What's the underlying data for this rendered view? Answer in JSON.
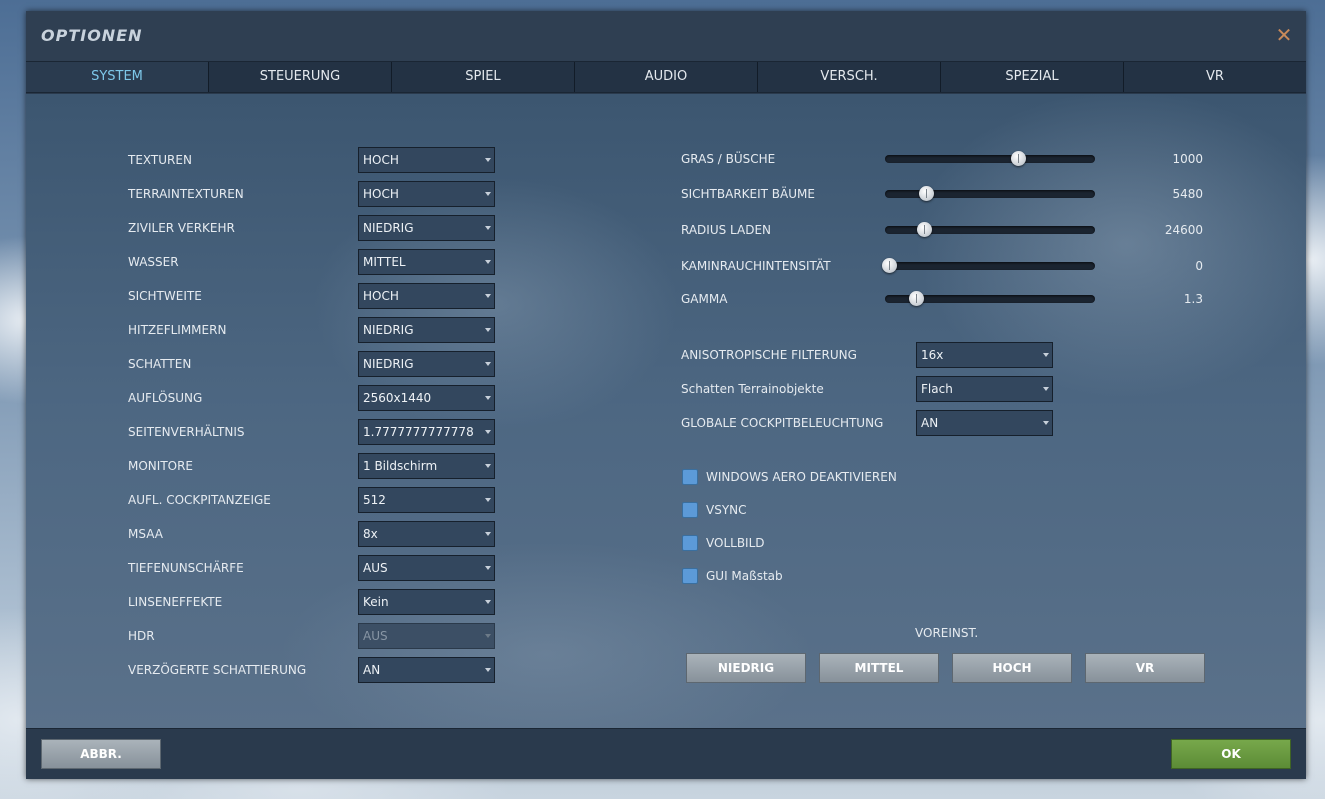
{
  "window": {
    "title": "OPTIONEN"
  },
  "tabs": [
    "SYSTEM",
    "STEUERUNG",
    "SPIEL",
    "AUDIO",
    "VERSCH.",
    "SPEZIAL",
    "VR"
  ],
  "left_settings": [
    {
      "label": "TEXTUREN",
      "value": "HOCH"
    },
    {
      "label": "TERRAINTEXTUREN",
      "value": "HOCH"
    },
    {
      "label": "ZIVILER VERKEHR",
      "value": "NIEDRIG"
    },
    {
      "label": "WASSER",
      "value": "MITTEL"
    },
    {
      "label": "SICHTWEITE",
      "value": "HOCH"
    },
    {
      "label": "HITZEFLIMMERN",
      "value": "NIEDRIG"
    },
    {
      "label": "SCHATTEN",
      "value": "NIEDRIG"
    },
    {
      "label": "AUFLÖSUNG",
      "value": "2560x1440"
    },
    {
      "label": "SEITENVERHÄLTNIS",
      "value": "1.7777777777778"
    },
    {
      "label": "MONITORE",
      "value": "1 Bildschirm"
    },
    {
      "label": "AUFL. COCKPITANZEIGE",
      "value": "512"
    },
    {
      "label": "MSAA",
      "value": "8x"
    },
    {
      "label": "TIEFENUNSCHÄRFE",
      "value": "AUS"
    },
    {
      "label": "LINSENEFFEKTE",
      "value": "Kein"
    },
    {
      "label": "HDR",
      "value": "AUS"
    },
    {
      "label": "VERZÖGERTE SCHATTIERUNG",
      "value": "AN"
    }
  ],
  "sliders": [
    {
      "label": "GRAS / BÜSCHE",
      "value": "1000",
      "fraction": 0.66
    },
    {
      "label": "SICHTBARKEIT BÄUME",
      "value": "5480",
      "fraction": 0.19
    },
    {
      "label": "RADIUS LADEN",
      "value": "24600",
      "fraction": 0.18
    },
    {
      "label": "KAMINRAUCHINTENSITÄT",
      "value": "0",
      "fraction": 0.0
    },
    {
      "label": "GAMMA",
      "value": "1.3",
      "fraction": 0.14
    }
  ],
  "right_settings": [
    {
      "label": "ANISOTROPISCHE FILTERUNG",
      "value": "16x"
    },
    {
      "label": "Schatten Terrainobjekte",
      "value": "Flach"
    },
    {
      "label": "GLOBALE COCKPITBELEUCHTUNG",
      "value": "AN"
    }
  ],
  "checkboxes": [
    {
      "label": "WINDOWS AERO DEAKTIVIEREN"
    },
    {
      "label": "VSYNC"
    },
    {
      "label": "VOLLBILD"
    },
    {
      "label": "GUI Maßstab"
    }
  ],
  "presets": {
    "label": "VOREINST.",
    "buttons": [
      "NIEDRIG",
      "MITTEL",
      "HOCH",
      "VR"
    ]
  },
  "footer": {
    "cancel_label": "ABBR.",
    "ok_label": "OK"
  },
  "colors": {
    "accent_tab": "#7ec8ea",
    "ok_button": "#6a9a40",
    "checkbox": "#5c9ad8",
    "close_icon": "#c88a5a"
  }
}
